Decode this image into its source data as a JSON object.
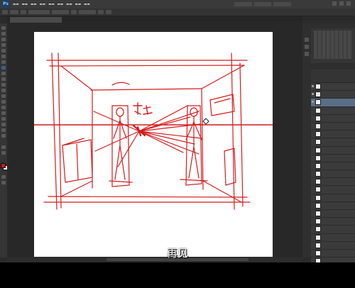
{
  "subtitle": "再见",
  "colors": {
    "sketch_red": "#d41c1c",
    "foreground": "#d01818",
    "background": "#ffffff",
    "active_layer": "#5a6f86"
  },
  "icons": [
    "photoshop-logo-icon",
    "eye-icon",
    "brush-icon",
    "move-icon",
    "lasso-icon",
    "zoom-icon"
  ]
}
